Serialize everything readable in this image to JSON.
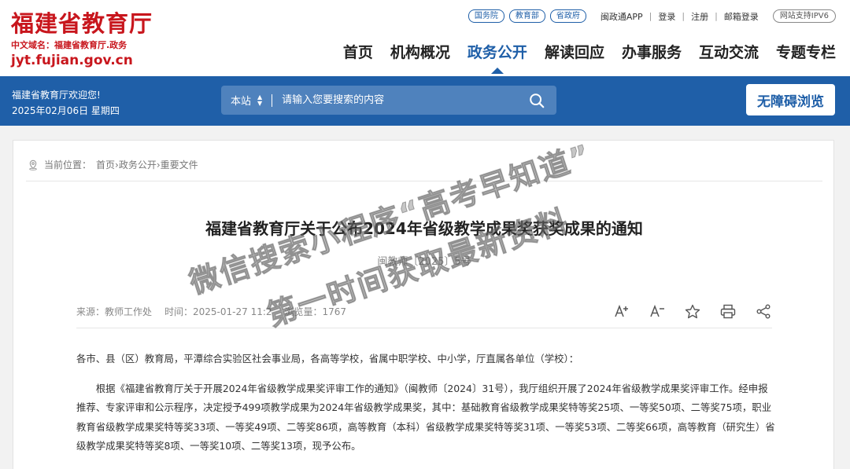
{
  "logo": {
    "title": "福建省教育厅",
    "subtitle": "中文域名：福建省教育厅.政务",
    "domain": "jyt.fujian.gov.cn"
  },
  "top_links": {
    "pills": [
      "国务院",
      "教育部",
      "省政府"
    ],
    "app": "闽政通APP",
    "login": "登录",
    "register": "注册",
    "mail": "邮箱登录",
    "ipv6": "网站支持IPV6"
  },
  "nav": {
    "items": [
      "首页",
      "机构概况",
      "政务公开",
      "解读回应",
      "办事服务",
      "互动交流",
      "专题专栏"
    ],
    "active_index": 2
  },
  "band": {
    "welcome": "福建省教育厅欢迎您!",
    "date": "2025年02月06日 星期四",
    "search_scope": "本站",
    "search_placeholder": "请输入您要搜索的内容",
    "access_button": "无障碍浏览"
  },
  "breadcrumb": {
    "label": "当前位置：",
    "items": [
      "首页",
      "政务公开",
      "重要文件"
    ],
    "sep": "›"
  },
  "article": {
    "title": "福建省教育厅关于公布2024年省级教学成果奖获奖成果的通知",
    "doc_no": "闽教师〔2025〕5号",
    "source": "来源：教师工作处",
    "time": "时间：2025-01-27 11:2",
    "views": "浏览量：1767",
    "paragraph1": "各市、县（区）教育局，平潭综合实验区社会事业局，各高等学校，省属中职学校、中小学，厅直属各单位（学校）：",
    "paragraph2": "根据《福建省教育厅关于开展2024年省级教学成果奖评审工作的通知》（闽教师〔2024〕31号），我厅组织开展了2024年省级教学成果奖评审工作。经申报推荐、专家评审和公示程序，决定授予499项教学成果为2024年省级教学成果奖，其中：基础教育省级教学成果奖特等奖25项、一等奖50项、二等奖75项，职业教育省级教学成果奖特等奖33项、一等奖49项、二等奖86项，高等教育（本科）省级教学成果奖特等奖31项、一等奖53项、二等奖66项，高等教育（研究生）省级教学成果奖特等奖8项、一等奖10项、二等奖13项，现予公布。"
  },
  "watermark": {
    "line1": "微信搜索小程序“高考早知道”",
    "line2": "第一时间获取最新资料"
  },
  "colors": {
    "brand_red": "#c8161d",
    "brand_blue": "#1f5fa8"
  }
}
